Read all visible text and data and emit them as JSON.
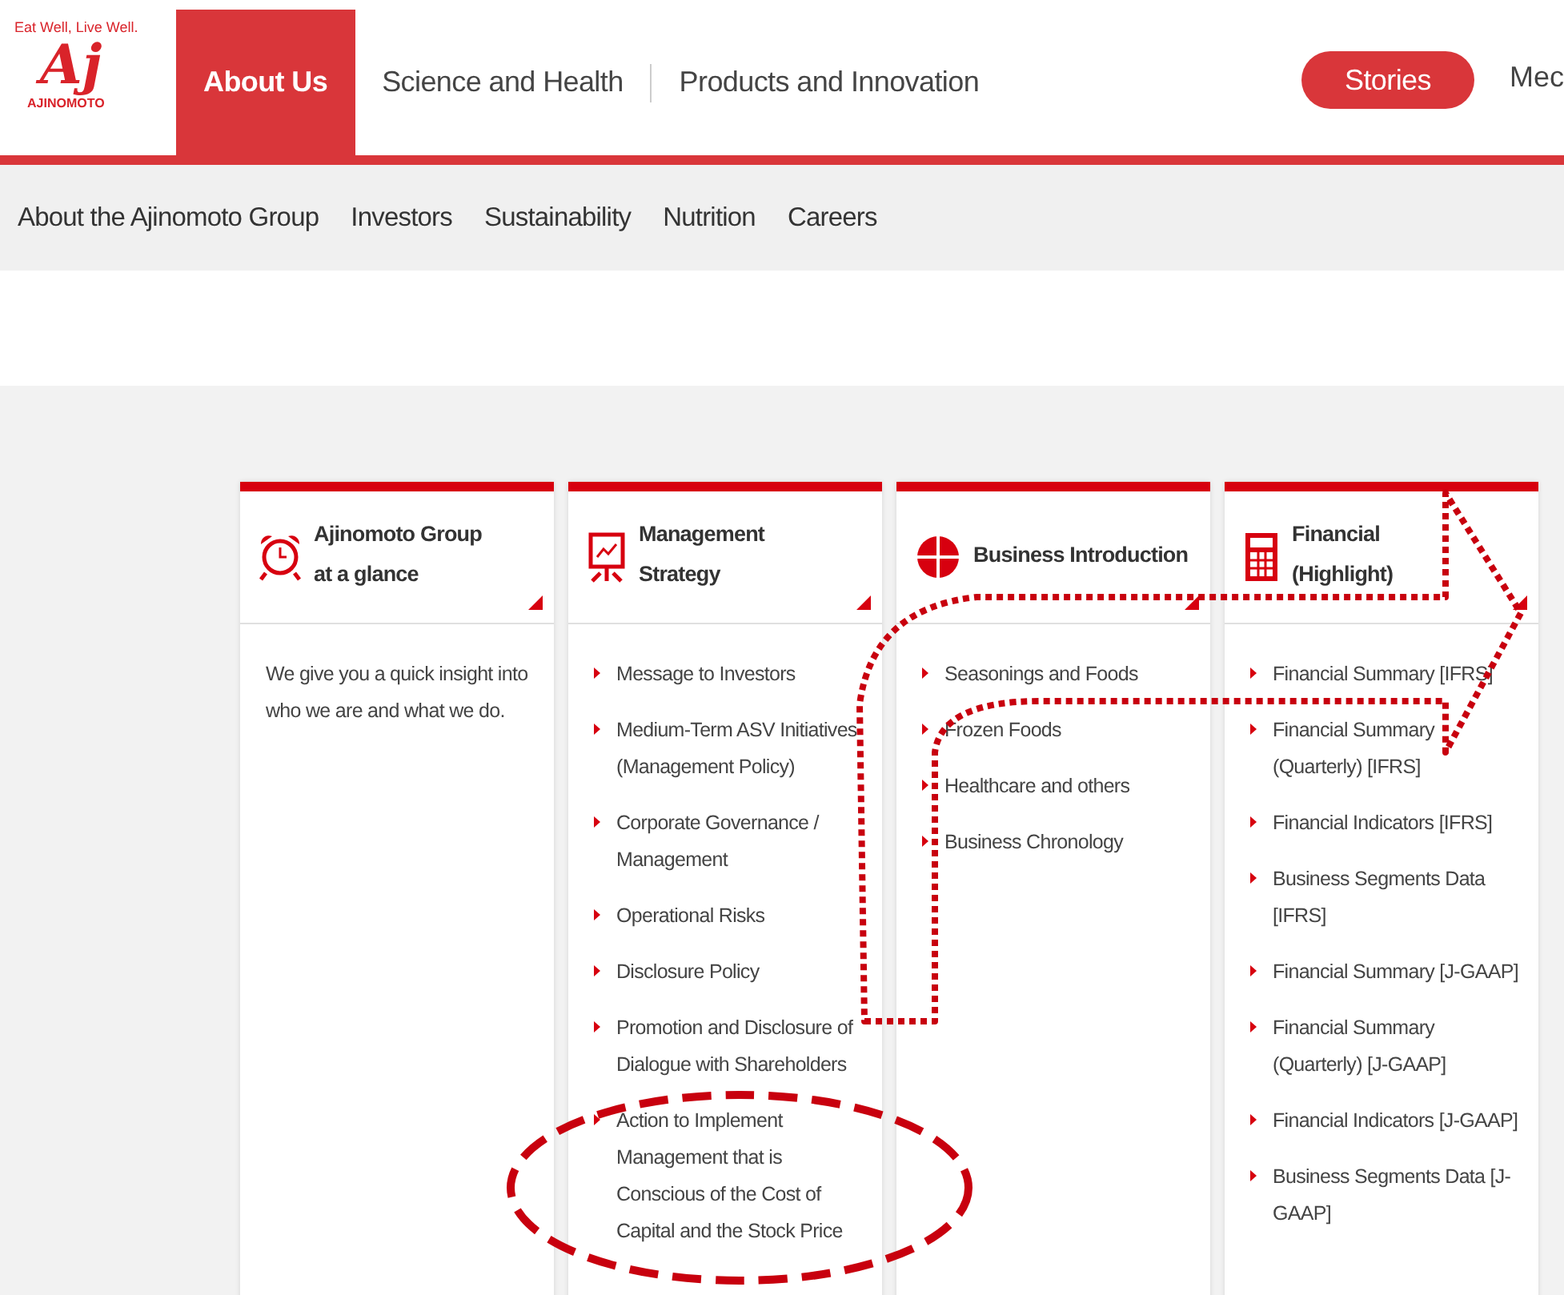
{
  "header": {
    "logo": {
      "tagline": "Eat Well, Live Well.",
      "mark": "Aj",
      "wordmark": "AJINOMOTO"
    },
    "nav": [
      {
        "label": "About Us",
        "selected": true
      },
      {
        "label": "Science and Health",
        "selected": false
      },
      {
        "label": "Products and Innovation",
        "selected": false
      }
    ],
    "stories_button": "Stories",
    "nav_cut": "Mec"
  },
  "subnav": [
    "About the Ajinomoto Group",
    "Investors",
    "Sustainability",
    "Nutrition",
    "Careers"
  ],
  "cards": [
    {
      "kind": "text",
      "title_lines": [
        "Ajinomoto Group",
        "at a glance"
      ],
      "text": "We give you a quick insight into who we are and what we do."
    },
    {
      "kind": "links",
      "title_lines": [
        "Management",
        "Strategy"
      ],
      "links": [
        "Message to Investors",
        "Medium-Term ASV Initiatives (Management Policy)",
        "Corporate Governance / Management",
        "Operational Risks",
        "Disclosure Policy",
        "Promotion and Disclosure of Dialogue with Shareholders",
        "Action to Implement Management that is Conscious of the Cost of Capital and the Stock Price"
      ]
    },
    {
      "kind": "links",
      "title_lines": [
        "Business Introduction"
      ],
      "links": [
        "Seasonings and Foods",
        "Frozen Foods",
        "Healthcare and others",
        "Business Chronology"
      ]
    },
    {
      "kind": "links",
      "title_lines": [
        "Financial",
        "(Highlight)"
      ],
      "links": [
        "Financial Summary [IFRS]",
        "Financial Summary (Quarterly) [IFRS]",
        "Financial Indicators [IFRS]",
        "Business Segments Data [IFRS]",
        "Financial Summary [J-GAAP]",
        "Financial Summary (Quarterly) [J-GAAP]",
        "Financial Indicators [J-GAAP]",
        "Business Segments Data [J-GAAP]"
      ]
    }
  ]
}
